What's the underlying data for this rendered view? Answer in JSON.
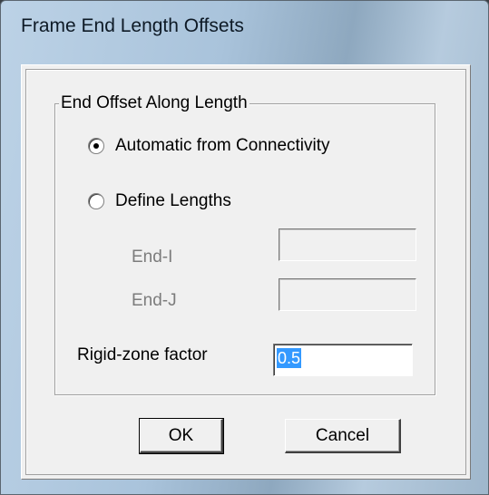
{
  "window": {
    "title": "Frame End Length Offsets"
  },
  "group": {
    "legend": "End Offset Along Length",
    "options": [
      {
        "label": "Automatic from Connectivity",
        "selected": true
      },
      {
        "label": "Define Lengths",
        "selected": false
      }
    ],
    "end_i": {
      "label": "End-I",
      "value": ""
    },
    "end_j": {
      "label": "End-J",
      "value": ""
    },
    "rigid_zone": {
      "label": "Rigid-zone factor",
      "value": "0.5"
    }
  },
  "buttons": {
    "ok": "OK",
    "cancel": "Cancel"
  }
}
